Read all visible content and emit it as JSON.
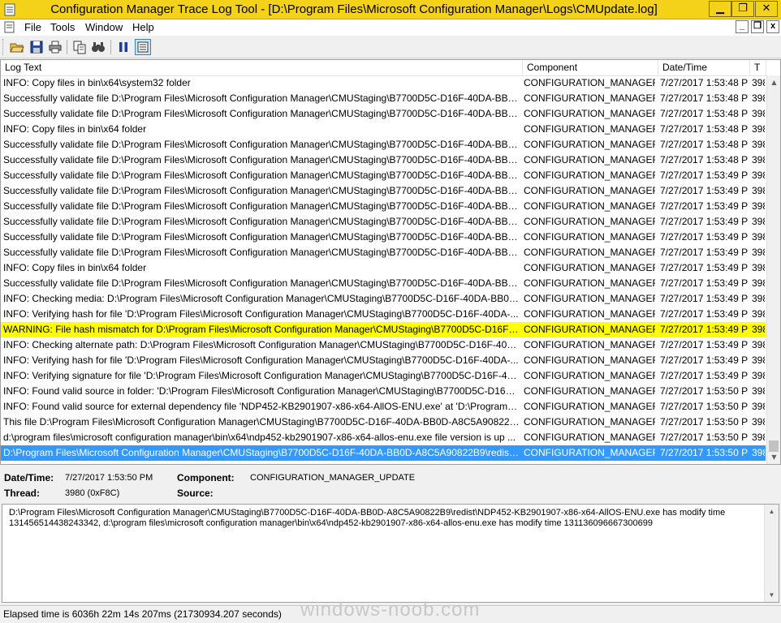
{
  "window": {
    "title": "Configuration Manager Trace Log Tool - [D:\\Program Files\\Microsoft Configuration Manager\\Logs\\CMUpdate.log]",
    "minimize_glyph": "▁",
    "maximize_glyph": "❐",
    "close_glyph": "✕"
  },
  "menu": {
    "items": [
      "File",
      "Tools",
      "Window",
      "Help"
    ],
    "mdi_minimize": "_",
    "mdi_restore": "❐",
    "mdi_close": "x"
  },
  "toolbar": {
    "icons": [
      "open-icon",
      "save-icon",
      "print-icon",
      "copy-icon",
      "find-icon",
      "pause-icon",
      "highlight-icon"
    ]
  },
  "grid": {
    "columns": [
      "Log Text",
      "Component",
      "Date/Time",
      "T"
    ],
    "rows": [
      {
        "text": "INFO: Copy files in bin\\x64\\system32 folder",
        "component": "CONFIGURATION_MANAGER_",
        "date": "7/27/2017 1:53:48 PM",
        "thread": "398",
        "state": "normal"
      },
      {
        "text": "Successfully validate file D:\\Program Files\\Microsoft Configuration Manager\\CMUStaging\\B7700D5C-D16F-40DA-BB0...",
        "component": "CONFIGURATION_MANAGER_",
        "date": "7/27/2017 1:53:48 PM",
        "thread": "398",
        "state": "normal"
      },
      {
        "text": "Successfully validate file D:\\Program Files\\Microsoft Configuration Manager\\CMUStaging\\B7700D5C-D16F-40DA-BB0...",
        "component": "CONFIGURATION_MANAGER_",
        "date": "7/27/2017 1:53:48 PM",
        "thread": "398",
        "state": "normal"
      },
      {
        "text": "INFO: Copy files in bin\\x64 folder",
        "component": "CONFIGURATION_MANAGER_",
        "date": "7/27/2017 1:53:48 PM",
        "thread": "398",
        "state": "normal"
      },
      {
        "text": "Successfully validate file D:\\Program Files\\Microsoft Configuration Manager\\CMUStaging\\B7700D5C-D16F-40DA-BB0...",
        "component": "CONFIGURATION_MANAGER_",
        "date": "7/27/2017 1:53:48 PM",
        "thread": "398",
        "state": "normal"
      },
      {
        "text": "Successfully validate file D:\\Program Files\\Microsoft Configuration Manager\\CMUStaging\\B7700D5C-D16F-40DA-BB0...",
        "component": "CONFIGURATION_MANAGER_",
        "date": "7/27/2017 1:53:48 PM",
        "thread": "398",
        "state": "normal"
      },
      {
        "text": "Successfully validate file D:\\Program Files\\Microsoft Configuration Manager\\CMUStaging\\B7700D5C-D16F-40DA-BB0...",
        "component": "CONFIGURATION_MANAGER_",
        "date": "7/27/2017 1:53:49 PM",
        "thread": "398",
        "state": "normal"
      },
      {
        "text": "Successfully validate file D:\\Program Files\\Microsoft Configuration Manager\\CMUStaging\\B7700D5C-D16F-40DA-BB0...",
        "component": "CONFIGURATION_MANAGER_",
        "date": "7/27/2017 1:53:49 PM",
        "thread": "398",
        "state": "normal"
      },
      {
        "text": "Successfully validate file D:\\Program Files\\Microsoft Configuration Manager\\CMUStaging\\B7700D5C-D16F-40DA-BB0...",
        "component": "CONFIGURATION_MANAGER_",
        "date": "7/27/2017 1:53:49 PM",
        "thread": "398",
        "state": "normal"
      },
      {
        "text": "Successfully validate file D:\\Program Files\\Microsoft Configuration Manager\\CMUStaging\\B7700D5C-D16F-40DA-BB0...",
        "component": "CONFIGURATION_MANAGER_",
        "date": "7/27/2017 1:53:49 PM",
        "thread": "398",
        "state": "normal"
      },
      {
        "text": "Successfully validate file D:\\Program Files\\Microsoft Configuration Manager\\CMUStaging\\B7700D5C-D16F-40DA-BB0...",
        "component": "CONFIGURATION_MANAGER_",
        "date": "7/27/2017 1:53:49 PM",
        "thread": "398",
        "state": "normal"
      },
      {
        "text": "Successfully validate file D:\\Program Files\\Microsoft Configuration Manager\\CMUStaging\\B7700D5C-D16F-40DA-BB0...",
        "component": "CONFIGURATION_MANAGER_",
        "date": "7/27/2017 1:53:49 PM",
        "thread": "398",
        "state": "normal"
      },
      {
        "text": "INFO: Copy files in bin\\x64 folder",
        "component": "CONFIGURATION_MANAGER_",
        "date": "7/27/2017 1:53:49 PM",
        "thread": "398",
        "state": "normal"
      },
      {
        "text": "Successfully validate file D:\\Program Files\\Microsoft Configuration Manager\\CMUStaging\\B7700D5C-D16F-40DA-BB0...",
        "component": "CONFIGURATION_MANAGER_",
        "date": "7/27/2017 1:53:49 PM",
        "thread": "398",
        "state": "normal"
      },
      {
        "text": "INFO: Checking media: D:\\Program Files\\Microsoft Configuration Manager\\CMUStaging\\B7700D5C-D16F-40DA-BB0D...",
        "component": "CONFIGURATION_MANAGER_",
        "date": "7/27/2017 1:53:49 PM",
        "thread": "398",
        "state": "normal"
      },
      {
        "text": "INFO: Verifying hash for file 'D:\\Program Files\\Microsoft Configuration Manager\\CMUStaging\\B7700D5C-D16F-40DA-...",
        "component": "CONFIGURATION_MANAGER_",
        "date": "7/27/2017 1:53:49 PM",
        "thread": "398",
        "state": "normal"
      },
      {
        "text": "WARNING: File hash mismatch for D:\\Program Files\\Microsoft Configuration Manager\\CMUStaging\\B7700D5C-D16F-...",
        "component": "CONFIGURATION_MANAGER_",
        "date": "7/27/2017 1:53:49 PM",
        "thread": "398",
        "state": "warning"
      },
      {
        "text": "INFO: Checking alternate path: D:\\Program Files\\Microsoft Configuration Manager\\CMUStaging\\B7700D5C-D16F-40D...",
        "component": "CONFIGURATION_MANAGER_",
        "date": "7/27/2017 1:53:49 PM",
        "thread": "398",
        "state": "normal"
      },
      {
        "text": "INFO: Verifying hash for file 'D:\\Program Files\\Microsoft Configuration Manager\\CMUStaging\\B7700D5C-D16F-40DA-...",
        "component": "CONFIGURATION_MANAGER_",
        "date": "7/27/2017 1:53:49 PM",
        "thread": "398",
        "state": "normal"
      },
      {
        "text": "INFO: Verifying signature for file 'D:\\Program Files\\Microsoft Configuration Manager\\CMUStaging\\B7700D5C-D16F-40...",
        "component": "CONFIGURATION_MANAGER_",
        "date": "7/27/2017 1:53:49 PM",
        "thread": "398",
        "state": "normal"
      },
      {
        "text": "INFO: Found valid source in folder: 'D:\\Program Files\\Microsoft Configuration Manager\\CMUStaging\\B7700D5C-D16F-...",
        "component": "CONFIGURATION_MANAGER_",
        "date": "7/27/2017 1:53:50 PM",
        "thread": "398",
        "state": "normal"
      },
      {
        "text": "INFO: Found valid source for external dependency file 'NDP452-KB2901907-x86-x64-AllOS-ENU.exe' at 'D:\\Program File...",
        "component": "CONFIGURATION_MANAGER_",
        "date": "7/27/2017 1:53:50 PM",
        "thread": "398",
        "state": "normal"
      },
      {
        "text": "This file D:\\Program Files\\Microsoft Configuration Manager\\CMUStaging\\B7700D5C-D16F-40DA-BB0D-A8C5A90822B...",
        "component": "CONFIGURATION_MANAGER_",
        "date": "7/27/2017 1:53:50 PM",
        "thread": "398",
        "state": "normal"
      },
      {
        "text": "d:\\program files\\microsoft configuration manager\\bin\\x64\\ndp452-kb2901907-x86-x64-allos-enu.exe file version is up ...",
        "component": "CONFIGURATION_MANAGER_",
        "date": "7/27/2017 1:53:50 PM",
        "thread": "398",
        "state": "normal"
      },
      {
        "text": "D:\\Program Files\\Microsoft Configuration Manager\\CMUStaging\\B7700D5C-D16F-40DA-BB0D-A8C5A90822B9\\redist\\...",
        "component": "CONFIGURATION_MANAGER_",
        "date": "7/27/2017 1:53:50 PM",
        "thread": "398",
        "state": "selected"
      }
    ]
  },
  "details": {
    "datetime_label": "Date/Time:",
    "datetime_value": "7/27/2017 1:53:50 PM",
    "component_label": "Component:",
    "component_value": "CONFIGURATION_MANAGER_UPDATE",
    "thread_label": "Thread:",
    "thread_value": "3980 (0xF8C)",
    "source_label": "Source:",
    "source_value": ""
  },
  "message": {
    "line1": "D:\\Program Files\\Microsoft Configuration Manager\\CMUStaging\\B7700D5C-D16F-40DA-BB0D-A8C5A90822B9\\redist\\NDP452-KB2901907-x86-x64-AllOS-ENU.exe has modify time",
    "line2": "131456514438243342, d:\\program files\\microsoft configuration manager\\bin\\x64\\ndp452-kb2901907-x86-x64-allos-enu.exe has modify time 131136096667300699"
  },
  "status": {
    "elapsed": "Elapsed time is 6036h 22m 14s 207ms (21730934.207 seconds)"
  },
  "watermark": "windows-noob.com",
  "colors": {
    "title_bar": "#f5d21a",
    "warning_row": "#ffff00",
    "selected_row": "#3399ff"
  }
}
